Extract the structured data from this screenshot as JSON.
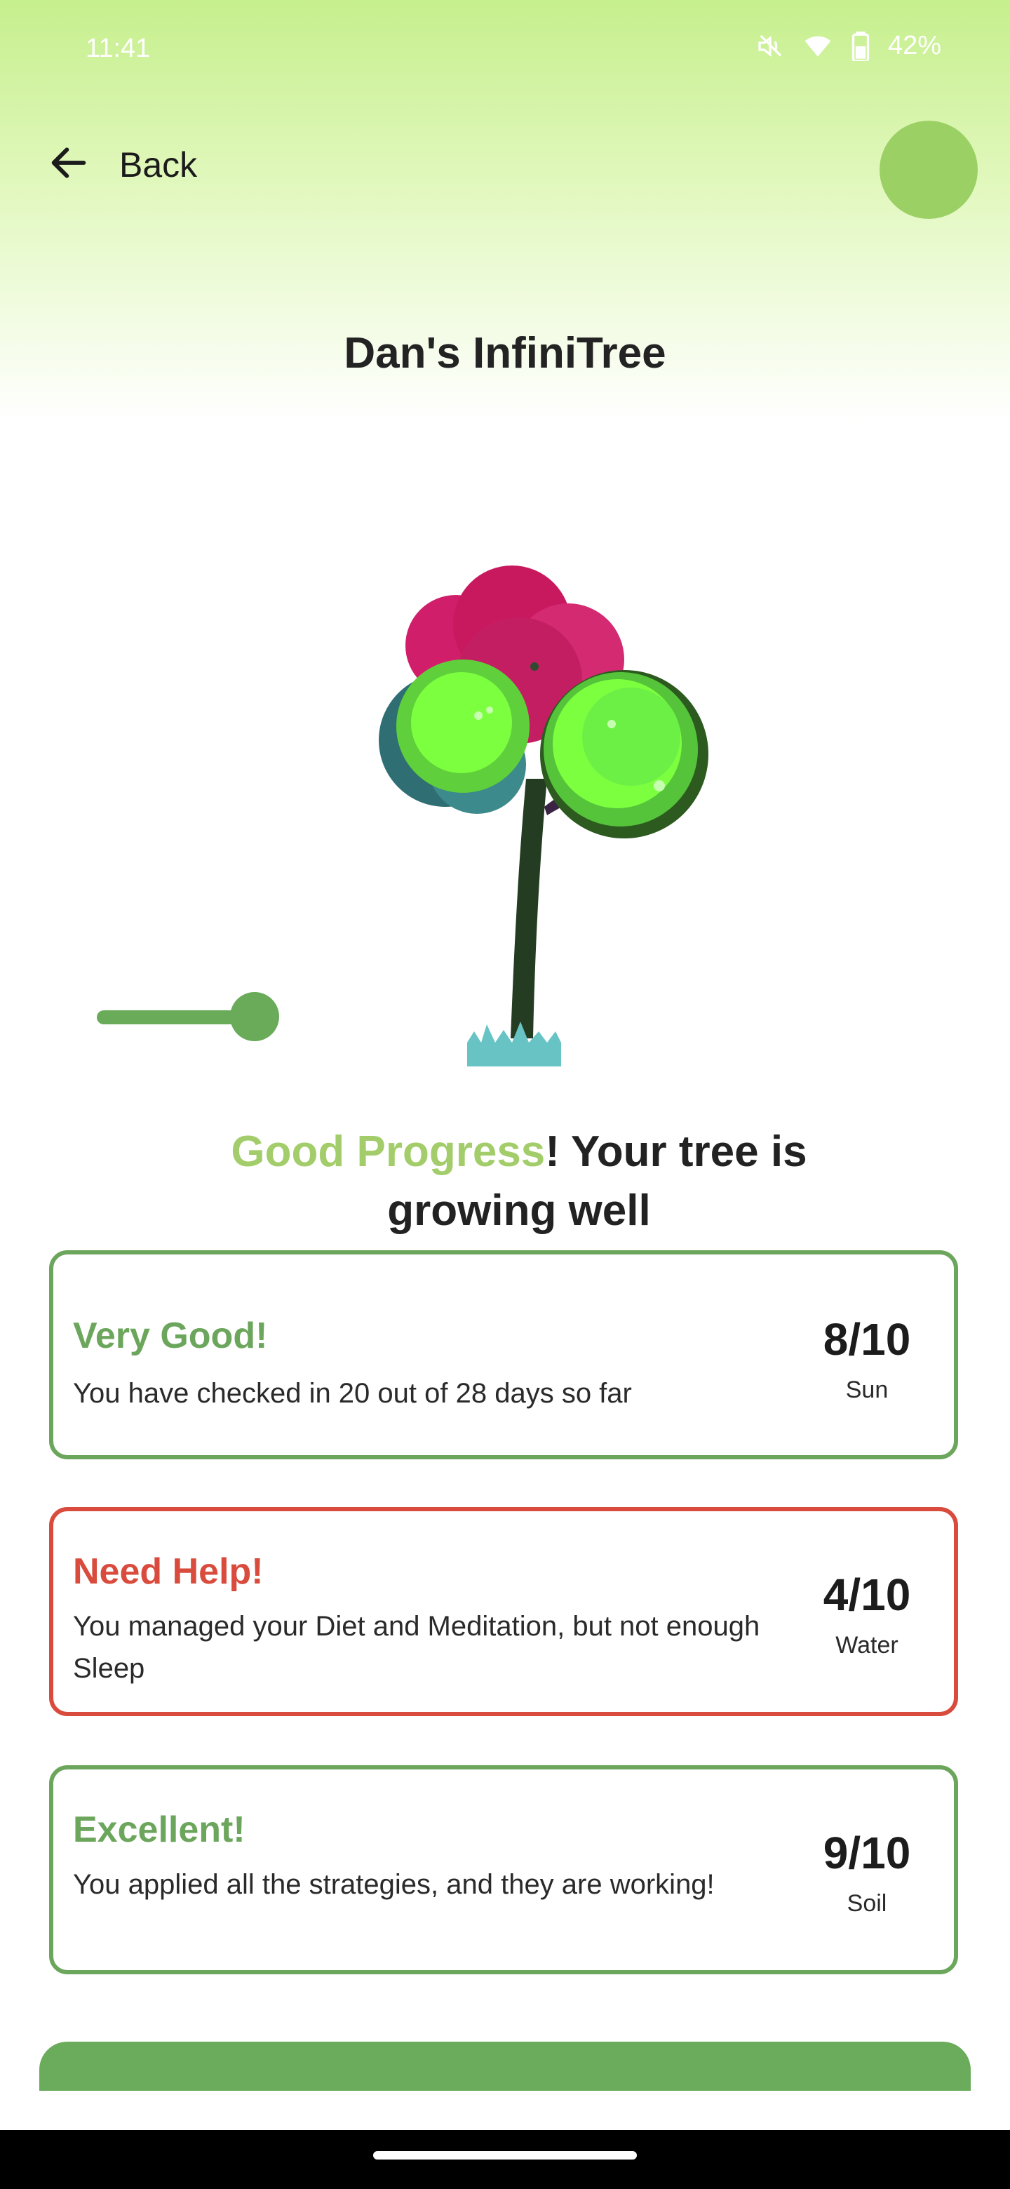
{
  "status_bar": {
    "time": "11:41",
    "battery": "42%"
  },
  "header": {
    "back_label": "Back"
  },
  "title": "Dan's InfiniTree",
  "headline": {
    "accent": "Good Progress",
    "rest": "! Your tree is growing well"
  },
  "cards": [
    {
      "status": "good",
      "label": "Very Good!",
      "description": "You have checked in 20 out of 28 days so far",
      "score": "8/10",
      "metric": "Sun"
    },
    {
      "status": "bad",
      "label": "Need Help!",
      "description": "You managed your Diet and Meditation, but not enough Sleep",
      "score": "4/10",
      "metric": "Water"
    },
    {
      "status": "good",
      "label": "Excellent!",
      "description": "You applied all the strategies, and they are working!",
      "score": "9/10",
      "metric": "Soil"
    }
  ],
  "slider": {
    "value_fraction": 1.0
  },
  "colors": {
    "good": "#6ca65c",
    "bad": "#d94c3d",
    "accent": "#a3cd6a",
    "avatar": "#9bd065"
  },
  "icons": [
    "mute-icon",
    "wifi-icon",
    "battery-icon",
    "back-arrow-icon"
  ]
}
